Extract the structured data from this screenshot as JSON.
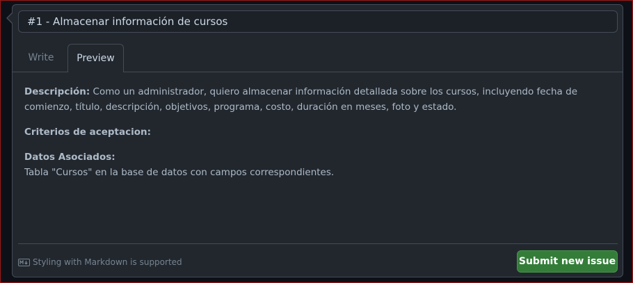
{
  "issue": {
    "title_value": "#1 - Almacenar información de cursos"
  },
  "tabs": [
    {
      "label": "Write",
      "active": false
    },
    {
      "label": "Preview",
      "active": true
    }
  ],
  "preview": {
    "description_label": "Descripción:",
    "description_text": " Como un administrador, quiero almacenar información detallada sobre los cursos, incluyendo fecha de comienzo, título, descripción, objetivos, programa, costo, duración en meses, foto y estado.",
    "criteria_label": "Criterios de aceptacion:",
    "data_label": "Datos Asociados:",
    "data_text": "Tabla \"Cursos\" en la base de datos con campos correspondientes."
  },
  "footer": {
    "markdown_note": "Styling with Markdown is supported",
    "submit_label": "Submit new issue"
  },
  "colors": {
    "background": "#22272e",
    "border": "#444c56",
    "submit_button": "#347d39",
    "muted_text": "#768390"
  },
  "icons": {
    "markdown": "markdown-icon"
  }
}
